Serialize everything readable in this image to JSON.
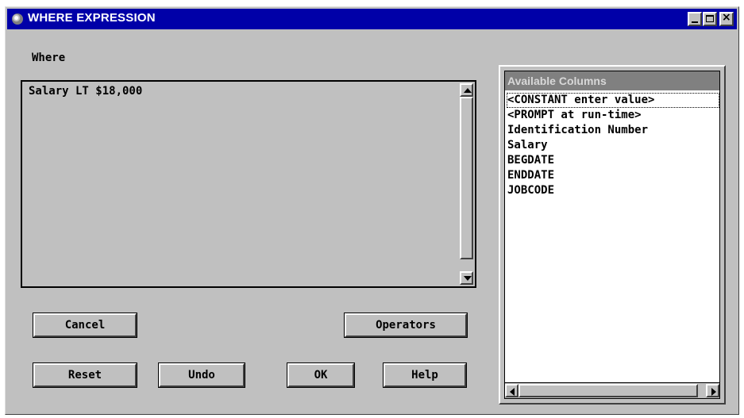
{
  "window": {
    "title": "WHERE EXPRESSION",
    "icon": "sas-app-icon",
    "controls": [
      "minimize",
      "maximize",
      "close"
    ]
  },
  "where": {
    "label": "Where",
    "expression": "Salary LT $18,000"
  },
  "buttons": {
    "cancel": "Cancel",
    "operators": "Operators",
    "reset": "Reset",
    "undo": "Undo",
    "ok": "OK",
    "help": "Help"
  },
  "columns": {
    "header": "Available Columns",
    "items": [
      "<CONSTANT enter value>",
      "<PROMPT at run-time>",
      "Identification Number",
      "Salary",
      "BEGDATE",
      "ENDDATE",
      "JOBCODE"
    ],
    "focused_index": 0
  },
  "colors": {
    "title_bar": "#0000a8",
    "face": "#c0c0c0",
    "list_header": "#808080"
  }
}
